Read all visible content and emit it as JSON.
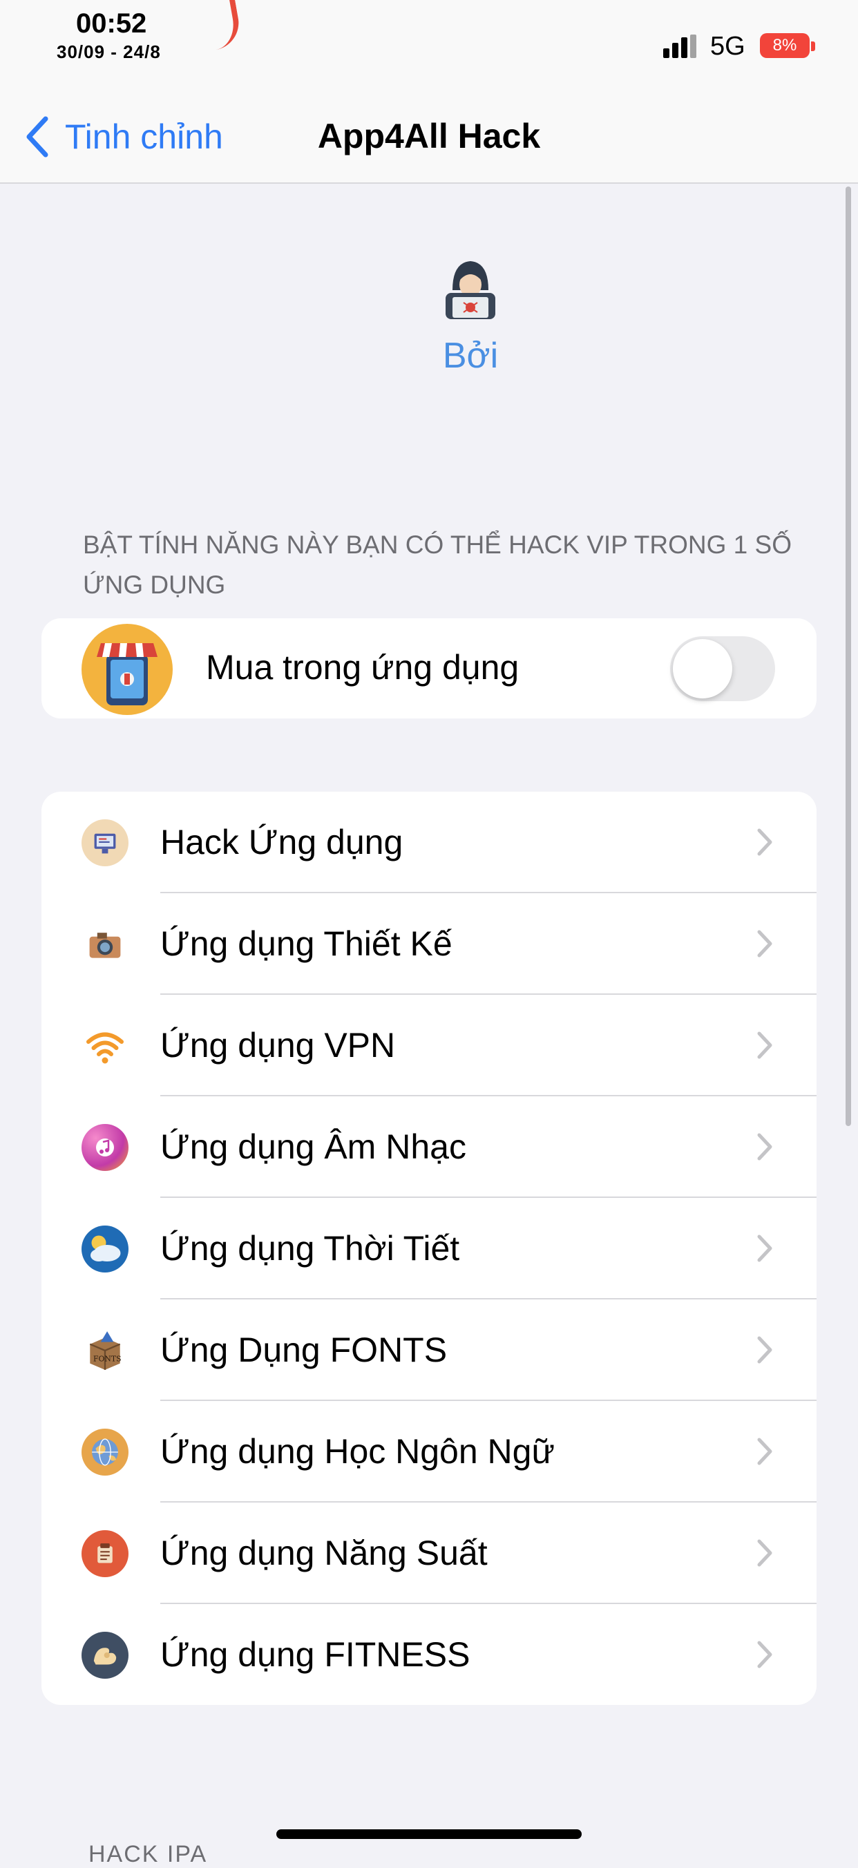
{
  "status": {
    "time": "00:52",
    "date": "30/09 - 24/8",
    "network": "5G",
    "battery": "8%"
  },
  "nav": {
    "back_label": "Tinh chỉnh",
    "title": "App4All Hack"
  },
  "header": {
    "name": "Bởi",
    "icon": "hacker-icon"
  },
  "section": {
    "caption": "BẬT TÍNH NĂNG NÀY BẠN CÓ THỂ HACK VIP TRONG 1 SỐ ỨNG DỤNG"
  },
  "iap": {
    "label": "Mua trong ứng dụng",
    "toggle_on": false,
    "icon": "store-icon"
  },
  "menu": {
    "items": [
      {
        "label": "Hack Ứng dụng",
        "icon": "computer-icon"
      },
      {
        "label": "Ứng dụng Thiết Kế",
        "icon": "camera-icon"
      },
      {
        "label": "Ứng dụng VPN",
        "icon": "wifi-icon"
      },
      {
        "label": "Ứng dụng Âm Nhạc",
        "icon": "music-icon"
      },
      {
        "label": "Ứng dụng Thời Tiết",
        "icon": "weather-icon"
      },
      {
        "label": "Ứng Dụng FONTS",
        "icon": "fonts-box-icon"
      },
      {
        "label": "Ứng dụng Học Ngôn Ngữ",
        "icon": "globe-icon"
      },
      {
        "label": "Ứng dụng Năng Suất",
        "icon": "productivity-icon"
      },
      {
        "label": "Ứng dụng FITNESS",
        "icon": "fitness-icon"
      }
    ]
  },
  "footer": {
    "caption": "HACK IPA"
  },
  "colors": {
    "accent": "#2F7BF5",
    "background": "#F2F2F7",
    "battery_low": "#F2443A"
  }
}
